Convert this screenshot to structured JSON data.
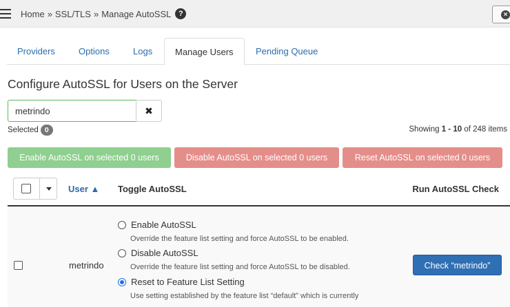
{
  "breadcrumb": {
    "items": [
      "Home",
      "SSL/TLS",
      "Manage AutoSSL"
    ],
    "separator": "»",
    "help_icon": "?",
    "close_icon": "×"
  },
  "tabs": [
    {
      "label": "Providers",
      "active": false
    },
    {
      "label": "Options",
      "active": false
    },
    {
      "label": "Logs",
      "active": false
    },
    {
      "label": "Manage Users",
      "active": true
    },
    {
      "label": "Pending Queue",
      "active": false
    }
  ],
  "page_title": "Configure AutoSSL for Users on the Server",
  "search": {
    "value": "metrindo",
    "clear_icon": "✖"
  },
  "selection": {
    "label": "Selected",
    "count": "0"
  },
  "pagination": {
    "prefix": "Showing",
    "range": "1 - 10",
    "suffix": "of 248 items"
  },
  "bulk_actions": {
    "enable": "Enable AutoSSL on selected 0 users",
    "disable": "Disable AutoSSL on selected 0 users",
    "reset": "Reset AutoSSL on selected 0 users"
  },
  "table": {
    "headers": {
      "user": "User ▲",
      "toggle": "Toggle AutoSSL",
      "run": "Run AutoSSL Check"
    },
    "rows": [
      {
        "user": "metrindo",
        "options": [
          {
            "label": "Enable AutoSSL",
            "description": "Override the feature list setting and force AutoSSL to be enabled.",
            "checked": false
          },
          {
            "label": "Disable AutoSSL",
            "description": "Override the feature list setting and force AutoSSL to be disabled.",
            "checked": false
          },
          {
            "label": "Reset to Feature List Setting",
            "description": "Use setting established by the feature list “default” which is currently",
            "checked": true
          }
        ],
        "check_button": "Check “metrindo”"
      }
    ]
  },
  "colors": {
    "link": "#2a6cae",
    "enable_button": "#8fcf8f",
    "danger_button": "#e48e8a",
    "primary_button": "#2f6fb3"
  }
}
